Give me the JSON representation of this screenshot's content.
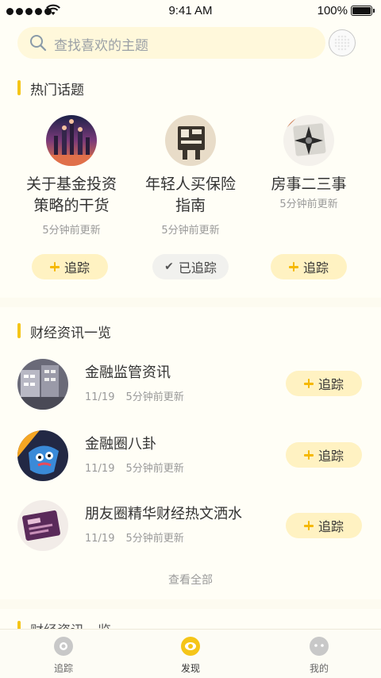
{
  "status_bar": {
    "time": "9:41 AM",
    "battery": "100%"
  },
  "search": {
    "placeholder": "查找喜欢的主题",
    "icon": "search-icon"
  },
  "hot_topics": {
    "title": "热门话题",
    "items": [
      {
        "name_line1": "关于基金投资",
        "name_line2": "策略的干货",
        "updated": "5分钟前更新",
        "action": "追踪",
        "tracked": false
      },
      {
        "name_line1": "年轻人买保险",
        "name_line2": "指南",
        "updated": "5分钟前更新",
        "action": "已追踪",
        "tracked": true
      },
      {
        "name_line1": "房事二三事",
        "name_line2": "",
        "updated": "5分钟前更新",
        "action": "追踪",
        "tracked": false
      }
    ]
  },
  "finance": {
    "title": "财经资讯一览",
    "items": [
      {
        "title": "金融监管资讯",
        "date": "11/19",
        "updated": "5分钟前更新",
        "action": "追踪"
      },
      {
        "title": "金融圈八卦",
        "date": "11/19",
        "updated": "5分钟前更新",
        "action": "追踪"
      },
      {
        "title": "朋友圈精华财经热文洒水",
        "date": "11/19",
        "updated": "5分钟前更新",
        "action": "追踪"
      }
    ],
    "see_all": "查看全部"
  },
  "next_section_title": "财经资讯一览",
  "tabs": [
    {
      "label": "追踪",
      "icon": "track-icon",
      "active": false
    },
    {
      "label": "发现",
      "icon": "discover-icon",
      "active": true
    },
    {
      "label": "我的",
      "icon": "profile-icon",
      "active": false
    }
  ],
  "colors": {
    "accent": "#f5c518",
    "pill_bg": "#fff2c2",
    "background": "#fffef6"
  }
}
